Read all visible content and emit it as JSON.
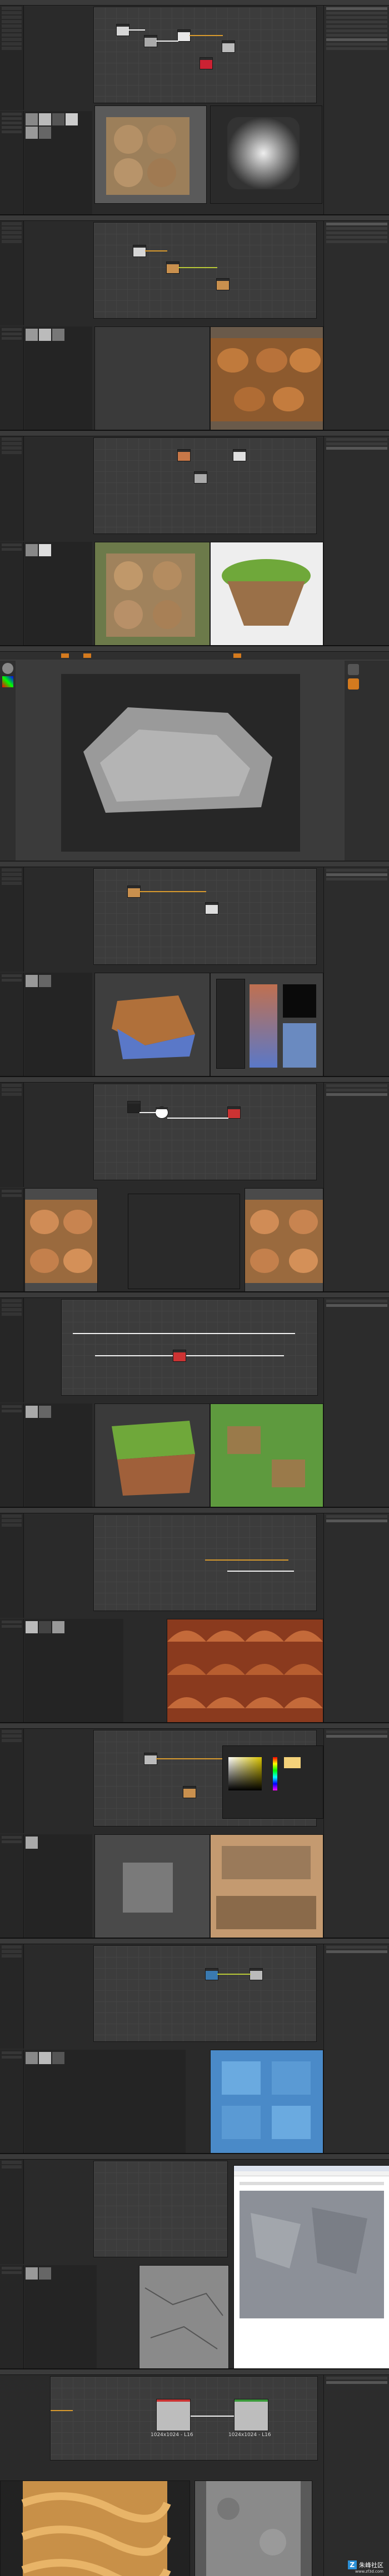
{
  "watermark": {
    "logo": "Z",
    "name": "朱峰社区",
    "url": "www.zf3d.com"
  },
  "panels": {
    "library": "Library",
    "graph": "Graph",
    "properties": "Properties",
    "explorer": "Explorer",
    "view_2d": "2D View",
    "view_3d": "3D View"
  },
  "node_resolutions": [
    "1024x1024 - L16",
    "1024x1024 - L16"
  ],
  "colors": {
    "accent": "#d89a2e",
    "wire": "#f2f2f2",
    "wire_green": "#b8c838",
    "brand": "#2b8fd6"
  }
}
